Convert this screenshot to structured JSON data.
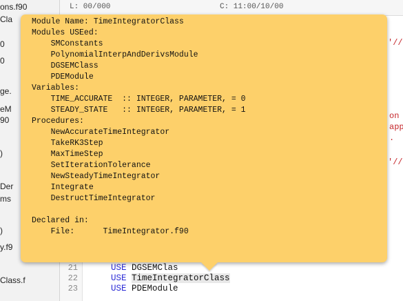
{
  "navigator": {
    "items": [
      {
        "label": "ons.f90"
      },
      {
        "label": "Cla"
      },
      {
        "label": "0"
      },
      {
        "label": "0"
      },
      {
        "label": "ge."
      },
      {
        "label": "eM"
      },
      {
        "label": "90"
      },
      {
        "label": ")"
      },
      {
        "label": "Der"
      },
      {
        "label": "ms"
      },
      {
        "label": ")"
      },
      {
        "label": "y.f9"
      },
      {
        "label": "Class.f"
      }
    ]
  },
  "topbar": {
    "left_text": "L: 00/000",
    "right_text": "C: 11:00/10/00"
  },
  "editor": {
    "lines": [
      {
        "num": "21",
        "keyword": "USE",
        "name": "DGSEMClas"
      },
      {
        "num": "22",
        "keyword": "USE",
        "name": "TimeIntegratorClass"
      },
      {
        "num": "23",
        "keyword": "USE",
        "name": "PDEModule"
      }
    ],
    "fragments": {
      "frag1": "'//.",
      "frag2": "on",
      "frag3": "app",
      "frag4": ".",
      "frag5": "'//."
    }
  },
  "popover": {
    "lines": [
      "Module Name: TimeIntegratorClass",
      "Modules USEed:",
      "    SMConstants",
      "    PolynomialInterpAndDerivsModule",
      "    DGSEMClass",
      "    PDEModule",
      "Variables:",
      "    TIME_ACCURATE  :: INTEGER, PARAMETER, = 0",
      "    STEADY_STATE   :: INTEGER, PARAMETER, = 1",
      "Procedures:",
      "    NewAccurateTimeIntegrator",
      "    TakeRK3Step",
      "    MaxTimeStep",
      "    SetIterationTolerance",
      "    NewSteadyTimeIntegrator",
      "    Integrate",
      "    DestructTimeIntegrator",
      "",
      "Declared in:",
      "    File:      TimeIntegrator.f90"
    ]
  },
  "colors": {
    "popover_bg": "#fdd06a",
    "keyword": "#2b2bd6",
    "string_red": "#c5262b"
  }
}
